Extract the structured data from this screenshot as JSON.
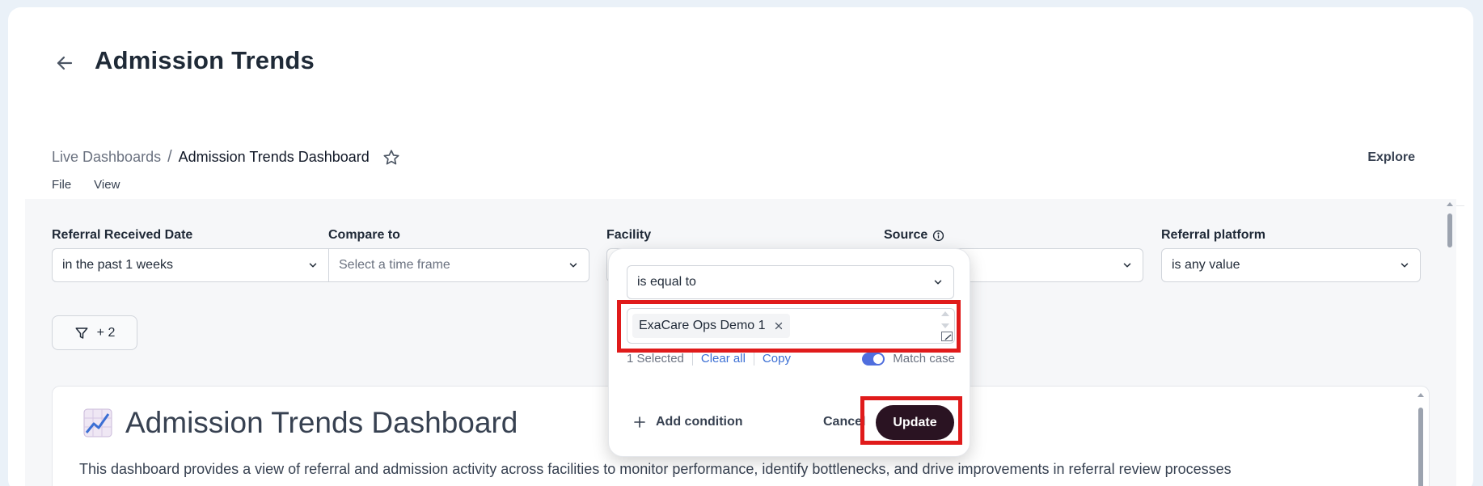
{
  "page": {
    "title": "Admission Trends",
    "explore_label": "Explore"
  },
  "breadcrumb": {
    "parent": "Live Dashboards",
    "separator": "/",
    "current": "Admission Trends Dashboard"
  },
  "menu": {
    "file": "File",
    "view": "View"
  },
  "filters": [
    {
      "label": "Referral Received Date",
      "value": "in the past 1 weeks"
    },
    {
      "label": "Compare to",
      "value": "Select a time frame",
      "placeholder": true
    },
    {
      "label": "Facility",
      "value": ""
    },
    {
      "label": "Source",
      "value": "",
      "icon": "info-icon"
    },
    {
      "label": "Referral platform",
      "value": "is any value"
    }
  ],
  "filter_chip": {
    "label": "+ 2",
    "icon": "funnel-icon"
  },
  "dashboard": {
    "title": "Admission Trends Dashboard",
    "icon": "chart-increasing-icon",
    "description": "This dashboard provides a view of referral and admission activity across facilities to monitor performance, identify bottlenecks, and drive improvements in referral review processes"
  },
  "popover": {
    "operator": "is equal to",
    "selected_tags": [
      "ExaCare Ops Demo 1"
    ],
    "selected_count": "1 Selected",
    "clear_all": "Clear all",
    "copy": "Copy",
    "match_case_label": "Match case",
    "match_case_on": true,
    "add_condition": "Add condition",
    "cancel": "Cancel",
    "update": "Update"
  },
  "colors": {
    "accent": "#4f6ede",
    "update_button": "#2a1322",
    "highlight": "#e01b1b",
    "link": "#3b6fd4"
  }
}
